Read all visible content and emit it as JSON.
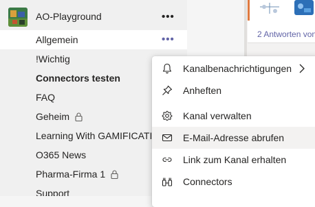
{
  "sidebar": {
    "team": {
      "name": "AO-Playground",
      "more": "•••"
    },
    "channels": [
      {
        "label": "Allgemein",
        "more": "•••"
      },
      {
        "label": "!Wichtig"
      },
      {
        "label": "Connectors testen"
      },
      {
        "label": "FAQ"
      },
      {
        "label": "Geheim",
        "icon": "lock-icon"
      },
      {
        "label": "Learning With GAMIFICATIC"
      },
      {
        "label": "O365 News"
      },
      {
        "label": "Pharma-Firma 1",
        "icon": "lock-icon"
      },
      {
        "label": "Support"
      }
    ]
  },
  "content": {
    "replies_link": "2 Antworten von"
  },
  "menu": {
    "items": [
      {
        "label": "Kanalbenachrichtigungen",
        "icon": "bell-icon"
      },
      {
        "label": "Anheften",
        "icon": "pin-icon"
      },
      {
        "label": "Kanal verwalten",
        "icon": "gear-icon"
      },
      {
        "label": "E-Mail-Adresse abrufen",
        "icon": "mail-icon"
      },
      {
        "label": "Link zum Kanal erhalten",
        "icon": "link-icon"
      },
      {
        "label": "Connectors",
        "icon": "connectors-icon"
      }
    ]
  },
  "colors": {
    "accent": "#6264a7",
    "hover": "#f3f2f1",
    "sidebar_bg": "#f0f0f0"
  }
}
